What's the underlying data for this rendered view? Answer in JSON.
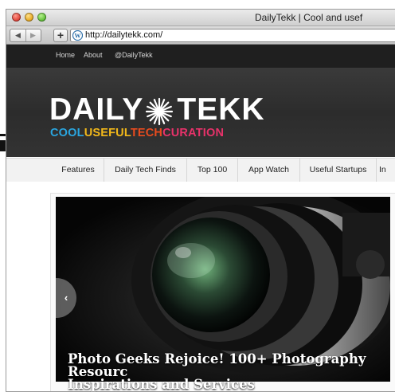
{
  "browser": {
    "window_title": "DailyTekk | Cool and usef",
    "url": "http://dailytekk.com/",
    "back_label": "◀",
    "forward_label": "▶",
    "add_label": "+"
  },
  "site": {
    "top_links": [
      "Home",
      "About",
      "@DailyTekk"
    ],
    "logo": {
      "left": "DAILY",
      "right": "TEKK",
      "tagline": {
        "cool": "COOL",
        "useful": "USEFUL",
        "tech": "TECH",
        "curation": "CURATION"
      }
    },
    "menu": [
      "Features",
      "Daily Tech Finds",
      "Top 100",
      "App Watch",
      "Useful Startups",
      "In"
    ],
    "slider": {
      "prev_label": "‹",
      "caption_line1": "Photo Geeks Rejoice! 100+ Photography Resourc",
      "caption_line2": "Inspirations and Services"
    }
  },
  "colors": {
    "cool": "#2aa6e0",
    "useful": "#f2b81a",
    "tech": "#e94b1e",
    "curation": "#e8326a",
    "header_bg": "#2f2f2f",
    "topnav_bg": "#1f1f1f"
  },
  "icons": {
    "close": "red-traffic-light",
    "minimize": "yellow-traffic-light",
    "zoom": "green-traffic-light",
    "favicon": "wordpress-icon",
    "logo_star": "starburst-icon"
  }
}
